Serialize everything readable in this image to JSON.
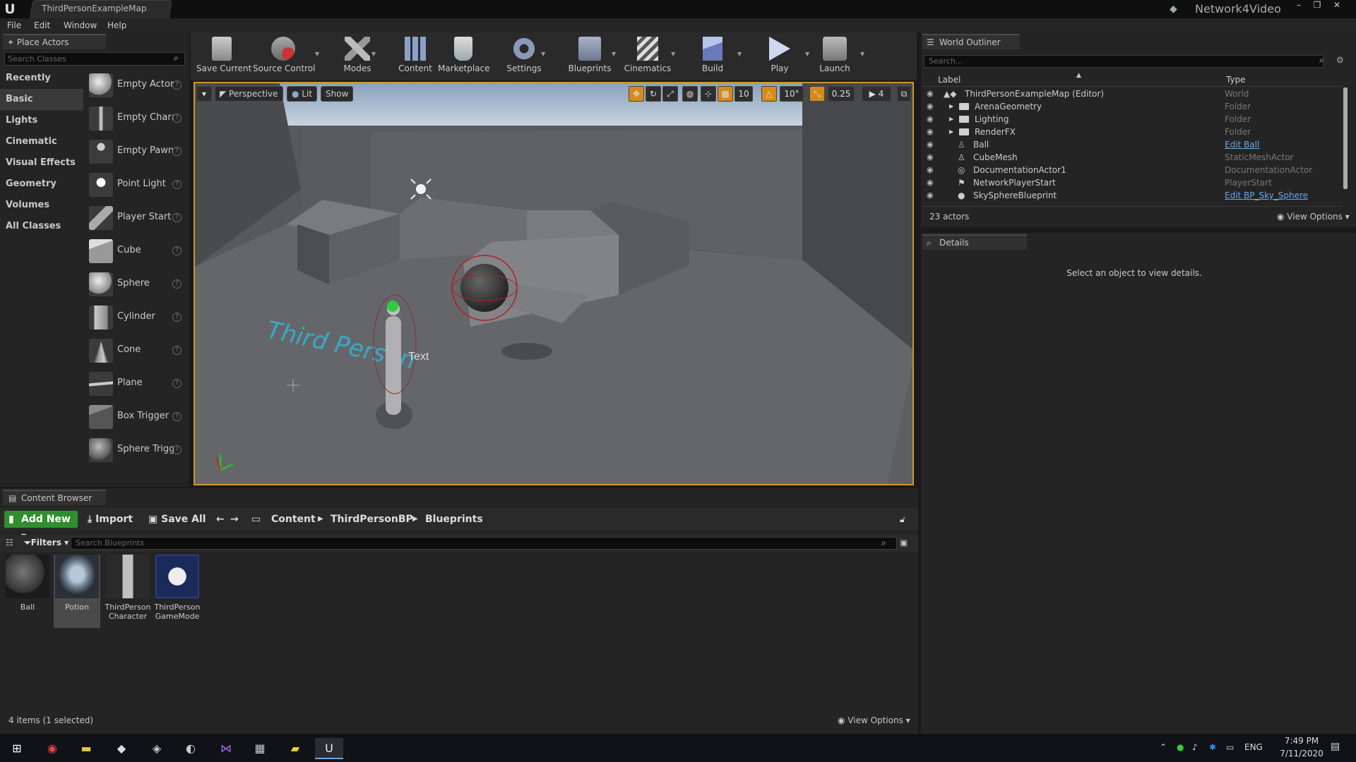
{
  "window": {
    "tab_title": "ThirdPersonExampleMap",
    "project_name": "Network4Video"
  },
  "menu": [
    "File",
    "Edit",
    "Window",
    "Help"
  ],
  "place_actors": {
    "tab": "Place Actors",
    "search_placeholder": "Search Classes",
    "categories": [
      "Recently Placed",
      "Basic",
      "Lights",
      "Cinematic",
      "Visual Effects",
      "Geometry",
      "Volumes",
      "All Classes"
    ],
    "selected_category": "Basic",
    "items": [
      "Empty Actor",
      "Empty Chara",
      "Empty Pawn",
      "Point Light",
      "Player Start",
      "Cube",
      "Sphere",
      "Cylinder",
      "Cone",
      "Plane",
      "Box Trigger",
      "Sphere Trigg"
    ]
  },
  "toolbar": {
    "save_current": "Save Current",
    "source_control": "Source Control",
    "modes": "Modes",
    "content": "Content",
    "marketplace": "Marketplace",
    "settings": "Settings",
    "blueprints": "Blueprints",
    "cinematics": "Cinematics",
    "build": "Build",
    "play": "Play",
    "launch": "Launch"
  },
  "viewport": {
    "perspective": "Perspective",
    "lit": "Lit",
    "show": "Show",
    "grid_snap": "10",
    "rotation_snap": "10°",
    "scale_snap": "0.25",
    "camera_speed": "4",
    "text_render": "Text",
    "floor_text": "Third Person"
  },
  "outliner": {
    "tab": "World Outliner",
    "search_placeholder": "Search...",
    "col_label": "Label",
    "col_type": "Type",
    "rows": [
      {
        "label": "ThirdPersonExampleMap (Editor)",
        "type": "World"
      },
      {
        "label": "ArenaGeometry",
        "type": "Folder"
      },
      {
        "label": "Lighting",
        "type": "Folder"
      },
      {
        "label": "RenderFX",
        "type": "Folder"
      },
      {
        "label": "Ball",
        "type": "Edit Ball"
      },
      {
        "label": "CubeMesh",
        "type": "StaticMeshActor"
      },
      {
        "label": "DocumentationActor1",
        "type": "DocumentationActor"
      },
      {
        "label": "NetworkPlayerStart",
        "type": "PlayerStart"
      },
      {
        "label": "SkySphereBlueprint",
        "type": "Edit BP_Sky_Sphere"
      }
    ],
    "count": "23 actors",
    "view_options": "View Options"
  },
  "details": {
    "tab": "Details",
    "empty_message": "Select an object to view details."
  },
  "content_browser": {
    "tab": "Content Browser",
    "add_new": "Add New",
    "import": "Import",
    "save_all": "Save All",
    "breadcrumb": [
      "Content",
      "ThirdPersonBP",
      "Blueprints"
    ],
    "filters": "Filters",
    "search_placeholder": "Search Blueprints",
    "assets": [
      {
        "name": "Ball",
        "name2": ""
      },
      {
        "name": "Potion",
        "name2": ""
      },
      {
        "name": "ThirdPerson",
        "name2": "Character"
      },
      {
        "name": "ThirdPerson",
        "name2": "GameMode"
      }
    ],
    "status": "4 items (1 selected)",
    "view_options": "View Options"
  },
  "taskbar": {
    "language": "ENG",
    "time": "7:49 PM",
    "date": "7/11/2020"
  }
}
